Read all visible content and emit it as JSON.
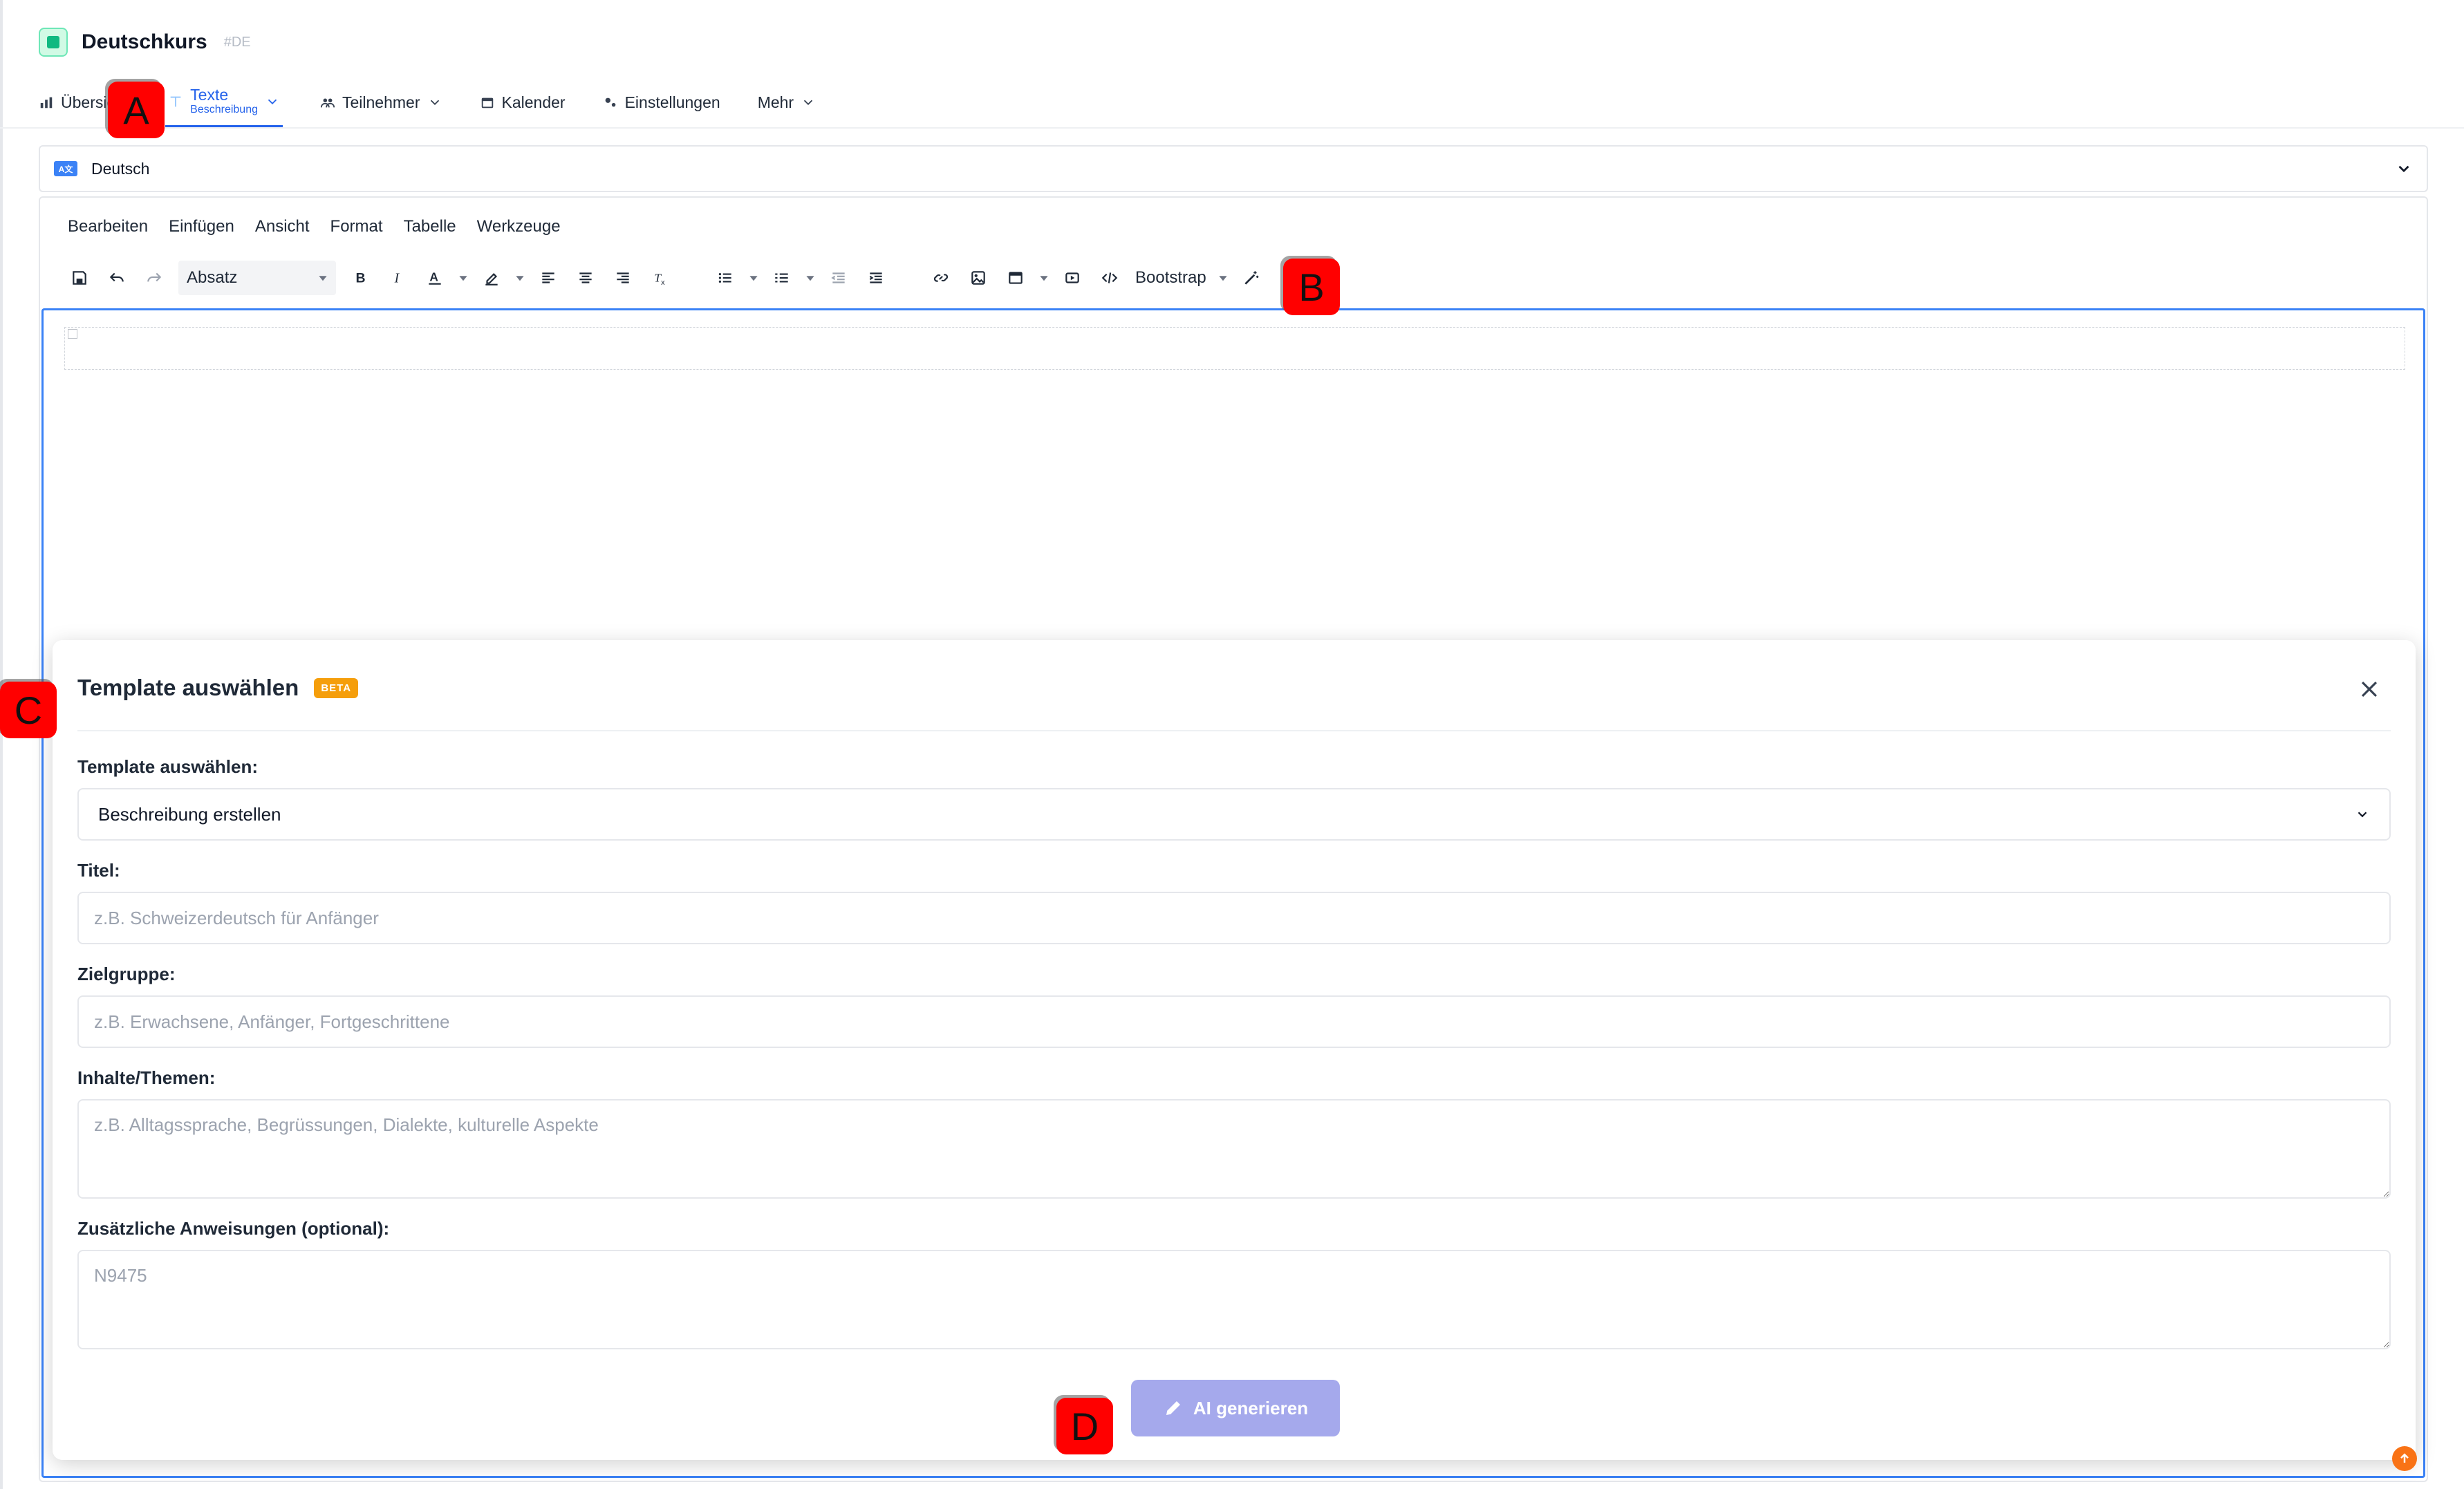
{
  "app": {
    "title": "Deutschkurs",
    "code": "#DE"
  },
  "nav": {
    "tabs": [
      {
        "label": "Übersicht"
      },
      {
        "label": "Texte",
        "sublabel": "Beschreibung"
      },
      {
        "label": "Teilnehmer"
      },
      {
        "label": "Kalender"
      },
      {
        "label": "Einstellungen"
      },
      {
        "label": "Mehr"
      }
    ]
  },
  "language": {
    "flag": "A文",
    "value": "Deutsch"
  },
  "editor": {
    "menu": [
      "Bearbeiten",
      "Einfügen",
      "Ansicht",
      "Format",
      "Tabelle",
      "Werkzeuge"
    ],
    "format_value": "Absatz",
    "bootstrap_label": "Bootstrap"
  },
  "modal": {
    "title": "Template auswählen",
    "badge": "BETA",
    "template_label": "Template auswählen:",
    "template_value": "Beschreibung erstellen",
    "title_label": "Titel:",
    "title_placeholder": "z.B. Schweizerdeutsch für Anfänger",
    "audience_label": "Zielgruppe:",
    "audience_placeholder": "z.B. Erwachsene, Anfänger, Fortgeschrittene",
    "topics_label": "Inhalte/Themen:",
    "topics_placeholder": "z.B. Alltagssprache, Begrüssungen, Dialekte, kulturelle Aspekte",
    "extra_label": "Zusätzliche Anweisungen (optional):",
    "extra_value": "N9475",
    "generate_label": "AI generieren"
  },
  "markers": [
    "A",
    "B",
    "C",
    "D"
  ],
  "colors": {
    "accent": "#2563eb",
    "beta": "#f59e0b",
    "ai_button": "#a5a9ec",
    "marker": "#ff0000"
  }
}
